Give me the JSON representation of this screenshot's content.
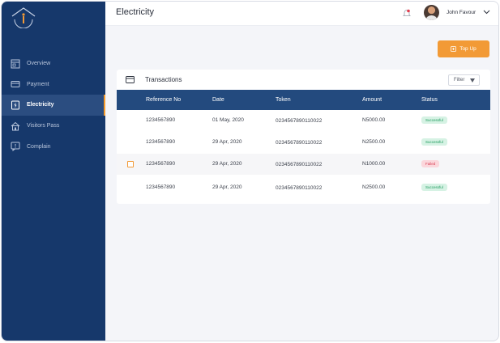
{
  "header": {
    "title": "Electricity",
    "user_name": "John Favour"
  },
  "sidebar": {
    "items": [
      {
        "label": "Overview",
        "icon": "overview-icon",
        "active": false
      },
      {
        "label": "Payment",
        "icon": "card-icon",
        "active": false
      },
      {
        "label": "Electricity",
        "icon": "electricity-icon",
        "active": true
      },
      {
        "label": "Visitors Pass",
        "icon": "house-icon",
        "active": false
      },
      {
        "label": "Complain",
        "icon": "complain-icon",
        "active": false
      }
    ]
  },
  "actions": {
    "top_up_label": "Top Up"
  },
  "transactions": {
    "title": "Transactions",
    "filter_label": "Filter",
    "columns": [
      "Reference No",
      "Date",
      "Token",
      "Amount",
      "Status"
    ],
    "rows": [
      {
        "reference": "1234567890",
        "date": "01 May, 2020",
        "token": "0234567890110022",
        "amount": "N5000.00",
        "status": "Successful",
        "status_type": "success",
        "highlighted": false
      },
      {
        "reference": "1234567890",
        "date": "29 Apr, 2020",
        "token": "0234567890110022",
        "amount": "N2500.00",
        "status": "Successful",
        "status_type": "success",
        "highlighted": false
      },
      {
        "reference": "1234567890",
        "date": "29 Apr, 2020",
        "token": "0234567890110022",
        "amount": "N1000.00",
        "status": "Failed",
        "status_type": "failed",
        "highlighted": true
      },
      {
        "reference": "1234567890",
        "date": "29 Apr, 2020",
        "token": "0234567890110022",
        "amount": "N2500.00",
        "status": "Successful",
        "status_type": "success",
        "highlighted": false
      }
    ]
  },
  "colors": {
    "sidebar": "#16386b",
    "sidebar_active": "#2b4d80",
    "accent": "#f29a36",
    "table_header": "#234a7e",
    "success": "#1d9a5c",
    "failed": "#d63a50"
  }
}
